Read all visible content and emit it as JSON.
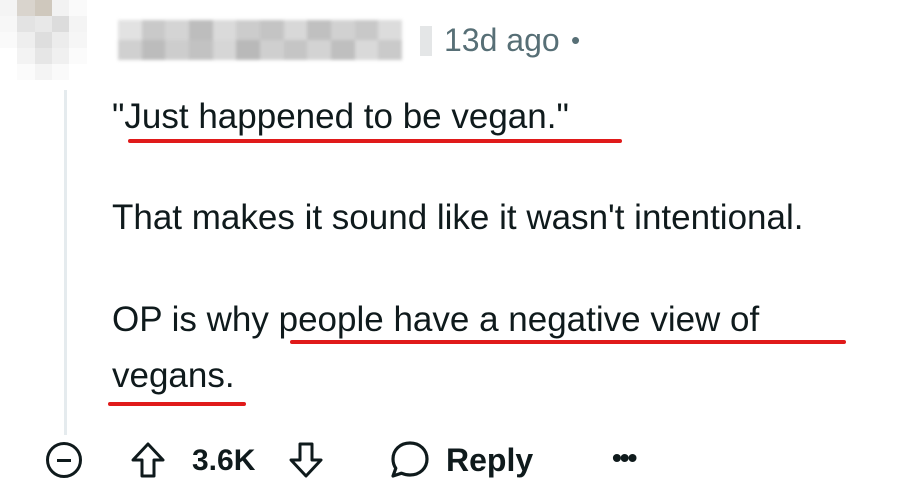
{
  "comment": {
    "timestamp": "13d ago",
    "separator": "•",
    "paragraphs": [
      "\"Just happened to be vegan.\"",
      "That makes it sound like it wasn't intentional.",
      "OP is why people have a negative view of",
      "vegans."
    ]
  },
  "actions": {
    "score": "3.6K",
    "reply_label": "Reply",
    "more_label": "•••"
  },
  "colors": {
    "underline": "#e01a1a",
    "text": "#0f1a1c",
    "meta": "#576f76"
  },
  "icons": {
    "collapse": "minus-circle-icon",
    "upvote": "arrow-up-outline-icon",
    "downvote": "arrow-down-outline-icon",
    "reply": "speech-bubble-icon",
    "more": "ellipsis-icon"
  }
}
